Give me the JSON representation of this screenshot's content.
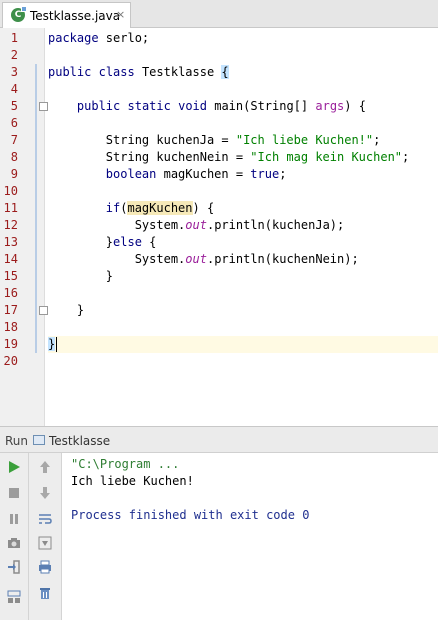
{
  "tab": {
    "filename": "Testklasse.java",
    "close_glyph": "×",
    "icon": "java-class-icon"
  },
  "editor": {
    "line_numbers": [
      "1",
      "2",
      "3",
      "4",
      "5",
      "6",
      "7",
      "8",
      "9",
      "10",
      "11",
      "12",
      "13",
      "14",
      "15",
      "16",
      "17",
      "18",
      "19",
      "20"
    ],
    "lines": {
      "l1_kw": "package",
      "l1_rest": " serlo;",
      "l3_kw1": "public",
      "l3_kw2": "class",
      "l3_name": " Testklasse ",
      "l3_brace": "{",
      "l5_kw1": "public",
      "l5_kw2": "static",
      "l5_kw3": "void",
      "l5_mid": " main(String[] ",
      "l5_par": "args",
      "l5_end": ") {",
      "l7_a": "String kuchenJa = ",
      "l7_str": "\"Ich liebe Kuchen!\"",
      "l7_end": ";",
      "l8_a": "String kuchenNein = ",
      "l8_str": "\"Ich mag kein Kuchen\"",
      "l8_end": ";",
      "l9_kw": "boolean",
      "l9_a": " magKuchen = ",
      "l9_kw2": "true",
      "l9_end": ";",
      "l11_kw": "if",
      "l11_p1": "(",
      "l11_var": "magKuchen",
      "l11_end": ") {",
      "l12_a": "System.",
      "l12_fld": "out",
      "l12_end": ".println(kuchenJa);",
      "l13_a": "}",
      "l13_kw": "else",
      "l13_end": " {",
      "l14_a": "System.",
      "l14_fld": "out",
      "l14_end": ".println(kuchenNein);",
      "l15": "}",
      "l17": "}",
      "l19": "}"
    }
  },
  "run": {
    "label": "Run",
    "config": "Testklasse",
    "toolbar_left": [
      "run-icon",
      "stop-icon",
      "pause-icon",
      "camera-icon",
      "exit-icon",
      "layout-icon"
    ],
    "toolbar_right": [
      "up-arrow-icon",
      "down-arrow-icon",
      "soft-wrap-icon",
      "scroll-to-end-icon",
      "print-icon",
      "trash-icon"
    ],
    "console_lines": [
      "\"C:\\Program ...",
      "Ich liebe Kuchen!",
      "",
      "Process finished with exit code 0"
    ]
  },
  "colors": {
    "keyword": "#000080",
    "string": "#008000",
    "field": "#9a1f9a",
    "line_number": "#9b1b1b",
    "caret_line": "#fffae3"
  }
}
